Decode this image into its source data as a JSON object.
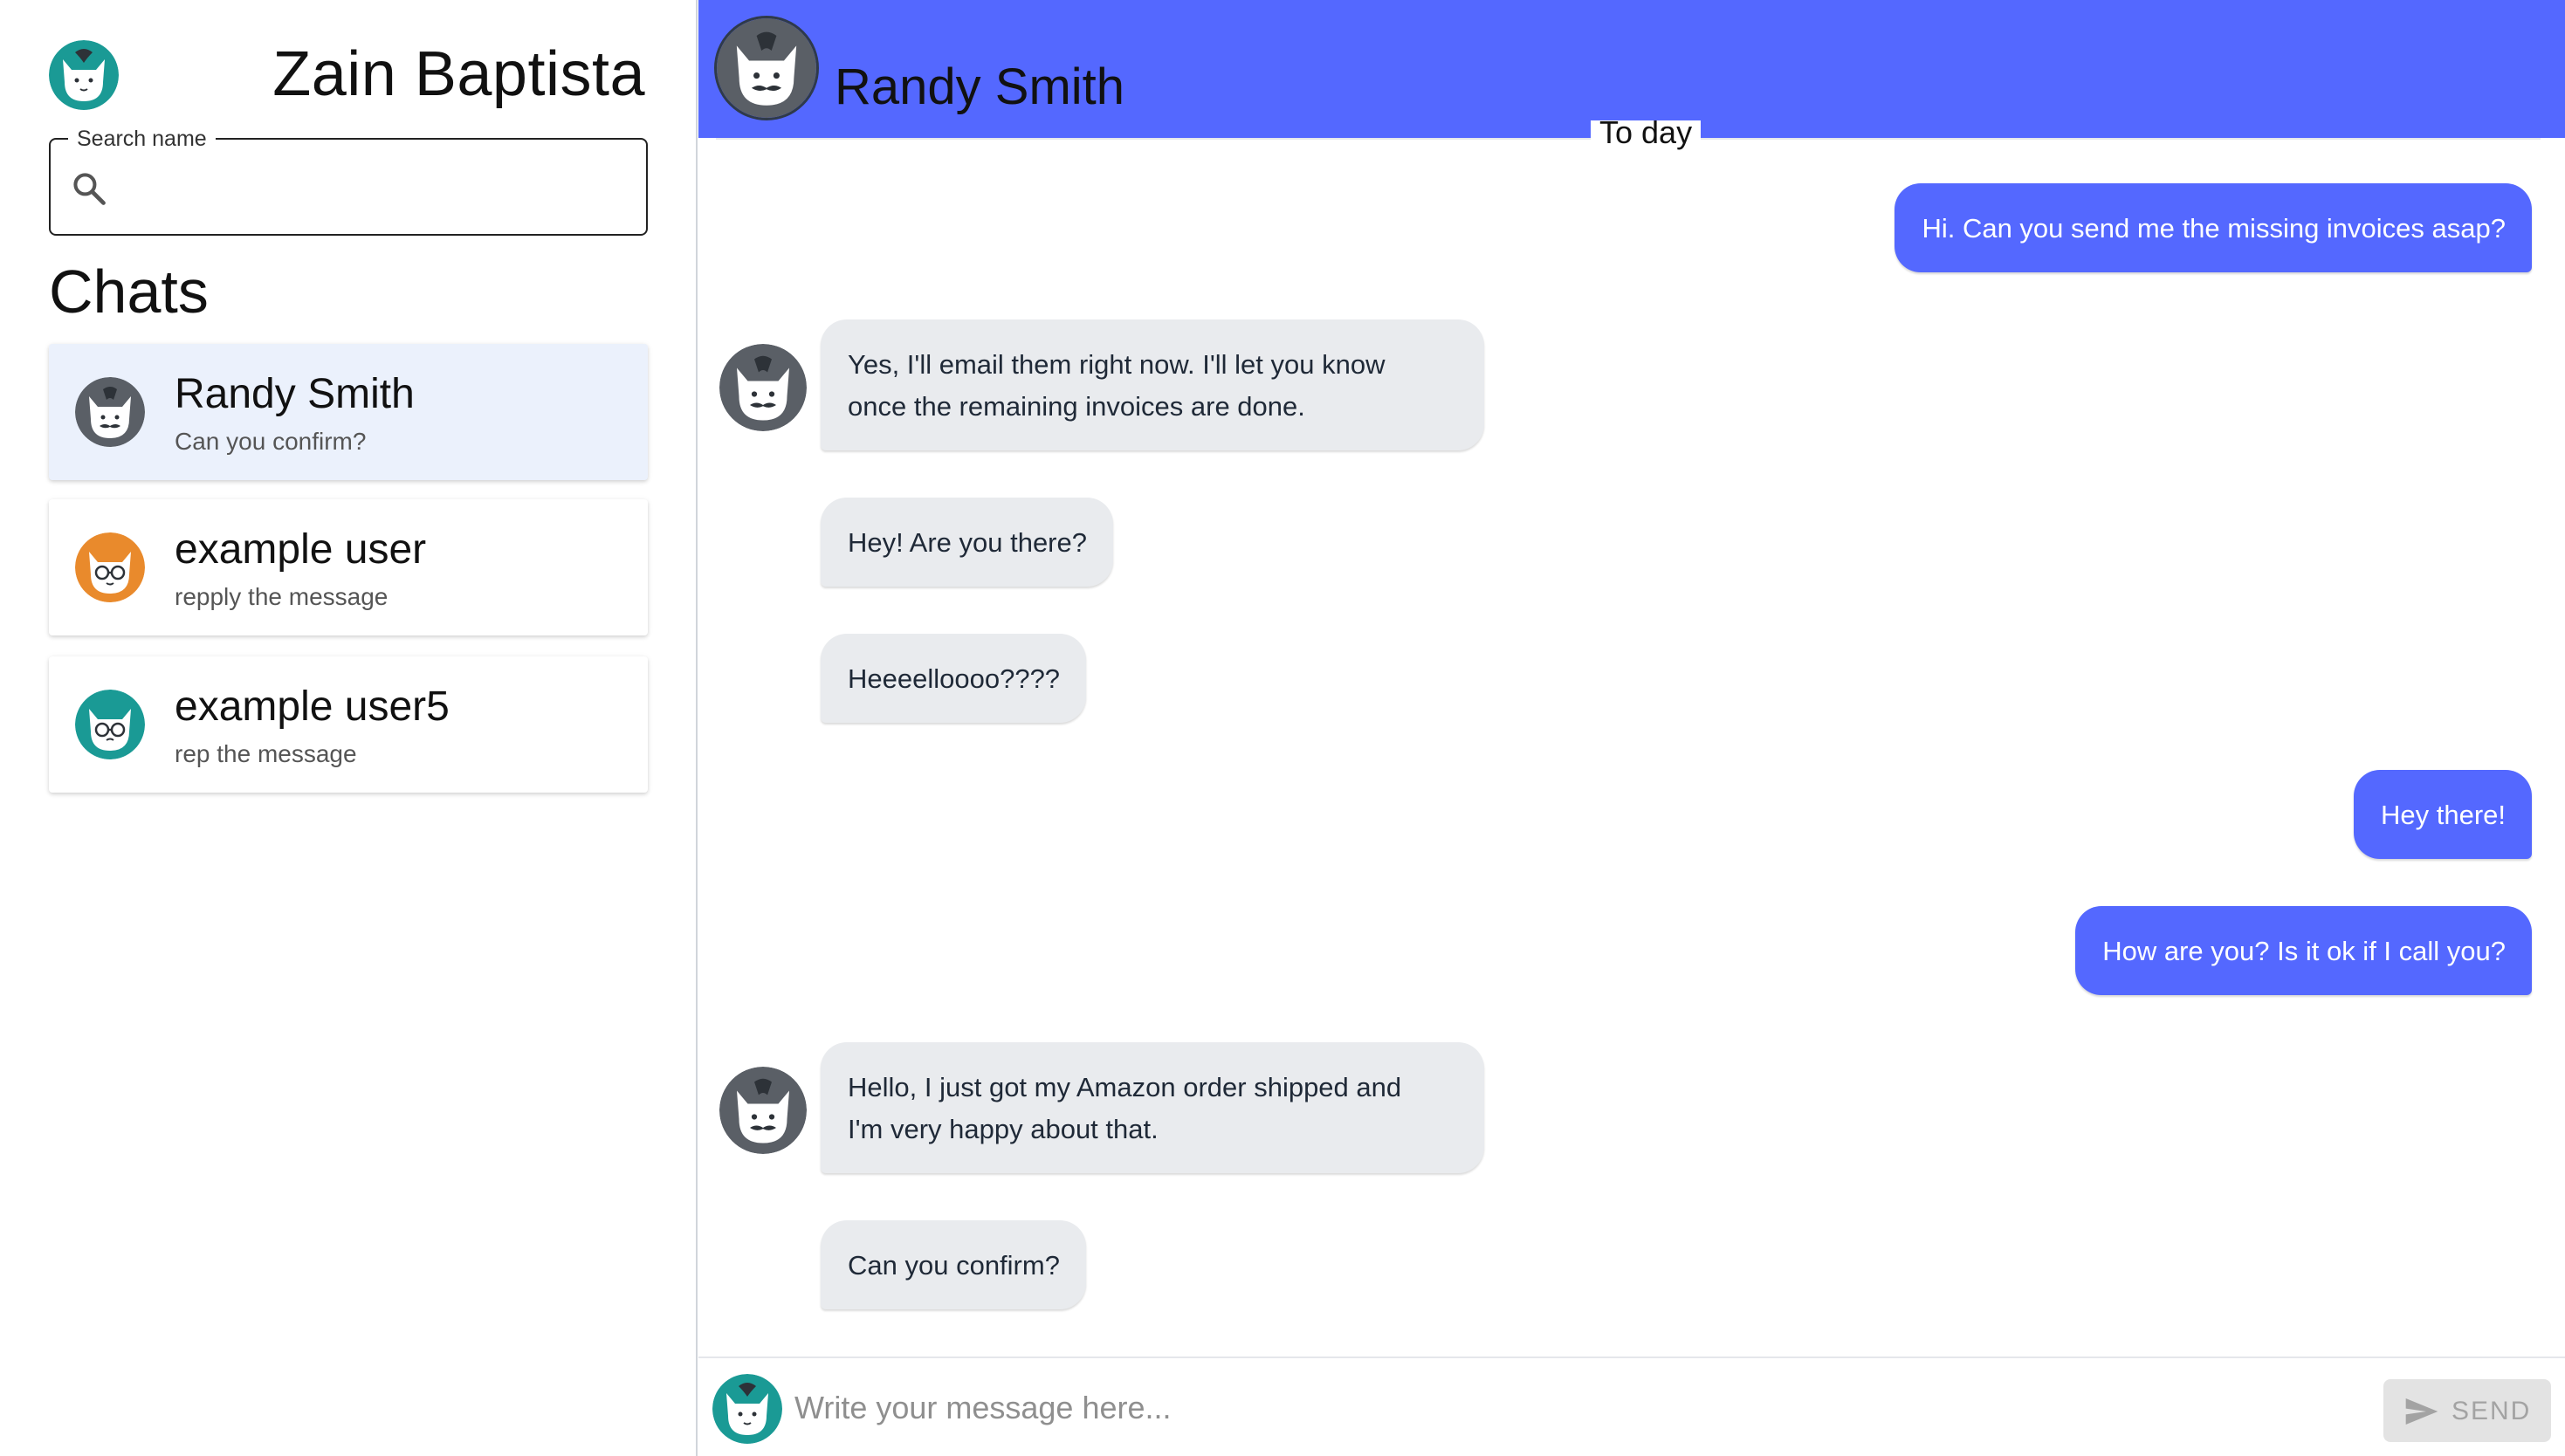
{
  "current_user": {
    "name": "Zain Baptista",
    "avatar_icon": "teal-cat-avatar"
  },
  "search": {
    "legend": "Search name",
    "value": "",
    "placeholder": ""
  },
  "sidebar": {
    "title": "Chats",
    "items": [
      {
        "name": "Randy Smith",
        "preview": "Can you confirm?",
        "avatar_icon": "grey-cat-mustache-avatar",
        "active": true
      },
      {
        "name": "example user",
        "preview": "repply the message",
        "avatar_icon": "orange-cat-glasses-avatar",
        "active": false
      },
      {
        "name": "example user5",
        "preview": "rep the message",
        "avatar_icon": "teal-cat-glasses-avatar",
        "active": false
      }
    ]
  },
  "conversation": {
    "contact_name": "Randy Smith",
    "day_label": "To day",
    "messages": [
      {
        "direction": "out",
        "lines": [
          "Hi. Can you send me the missing invoices asap?"
        ]
      },
      {
        "direction": "in",
        "lines": [
          "Yes, I'll email them right now. I'll let you know",
          "once the remaining invoices are done."
        ],
        "avatar": true
      },
      {
        "direction": "in",
        "lines": [
          "Hey! Are you there?"
        ]
      },
      {
        "direction": "in",
        "lines": [
          "Heeeelloooo????"
        ]
      },
      {
        "direction": "out",
        "lines": [
          "Hey there!"
        ]
      },
      {
        "direction": "out",
        "lines": [
          "How are you? Is it ok if I call you?"
        ]
      },
      {
        "direction": "in",
        "lines": [
          "Hello, I just got my Amazon order shipped and",
          "I'm very happy about that."
        ],
        "avatar": true
      },
      {
        "direction": "in",
        "lines": [
          "Can you confirm?"
        ]
      }
    ]
  },
  "composer": {
    "placeholder": "Write your message here...",
    "send_label": "SEND",
    "send_icon": "send-arrow-icon"
  },
  "colors": {
    "accent": "#5468ff",
    "incoming_bubble": "#e9ebee",
    "active_chat": "#ebf1fc",
    "teal": "#1a9a95",
    "orange": "#e98a2c",
    "grey_avatar": "#5a5f66"
  }
}
